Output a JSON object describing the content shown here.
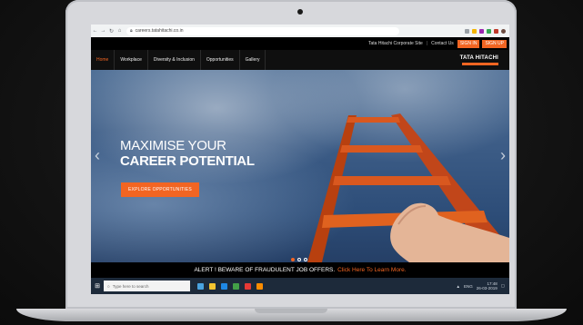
{
  "browser": {
    "url": "careers.tatahitachi.co.in",
    "nav_icons": [
      "back-icon",
      "forward-icon",
      "reload-icon",
      "home-icon"
    ]
  },
  "site": {
    "top_links": [
      "Tata Hitachi Corporate Site",
      "Contact Us"
    ],
    "sign_in_label": "SIGN IN",
    "sign_up_label": "SIGN UP",
    "nav_items": [
      "Home",
      "Workplace",
      "Diversity & Inclusion",
      "Opportunities",
      "Gallery"
    ],
    "logo": "TATA HITACHI"
  },
  "hero": {
    "line1": "MAXIMISE YOUR",
    "line2": "CAREER POTENTIAL",
    "cta_label": "EXPLORE OPPORTUNITIES",
    "slide_count": 3,
    "active_slide": 1
  },
  "alert": {
    "text": "ALERT ! BEWARE OF FRAUDULENT JOB OFFERS.",
    "link": "Click Here To Learn More."
  },
  "taskbar": {
    "search_placeholder": "Type here to search",
    "lang": "ENG",
    "time": "17:48",
    "date": "26-03-2019"
  },
  "colors": {
    "accent": "#f26522",
    "nav_bg": "#0f0f0f",
    "taskbar_bg": "#1d2a3a"
  }
}
